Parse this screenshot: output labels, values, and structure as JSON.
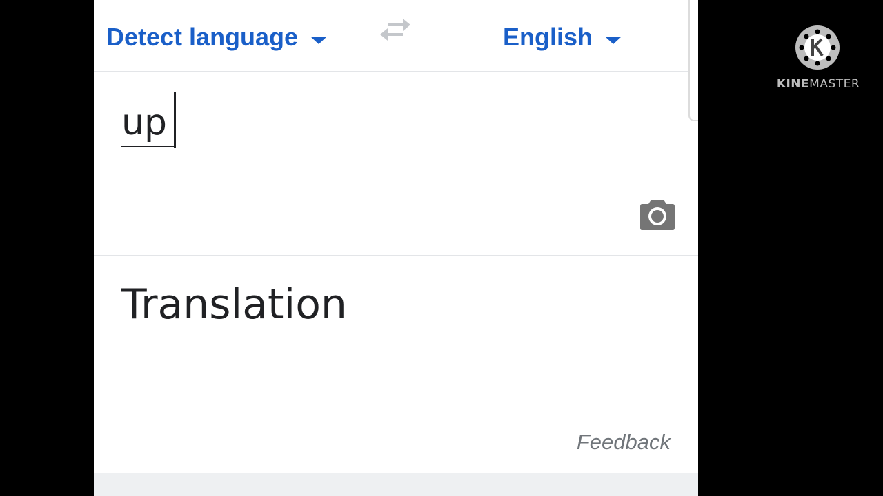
{
  "language_bar": {
    "source_language": "Detect language",
    "target_language": "English",
    "swap_icon": "swap-arrows-icon",
    "dropdown_icon": "caret-down-icon"
  },
  "input": {
    "text": "up",
    "camera_icon": "camera-icon"
  },
  "output": {
    "placeholder": "Translation",
    "feedback_label": "Feedback"
  },
  "watermark": {
    "brand_prefix": "KINE",
    "brand_suffix": "MASTER"
  },
  "colors": {
    "accent": "#1a5fc8",
    "text": "#202124",
    "muted": "#70757a",
    "divider": "#e3e5e8",
    "watermark": "#bdbdbd",
    "background": "#000000"
  }
}
